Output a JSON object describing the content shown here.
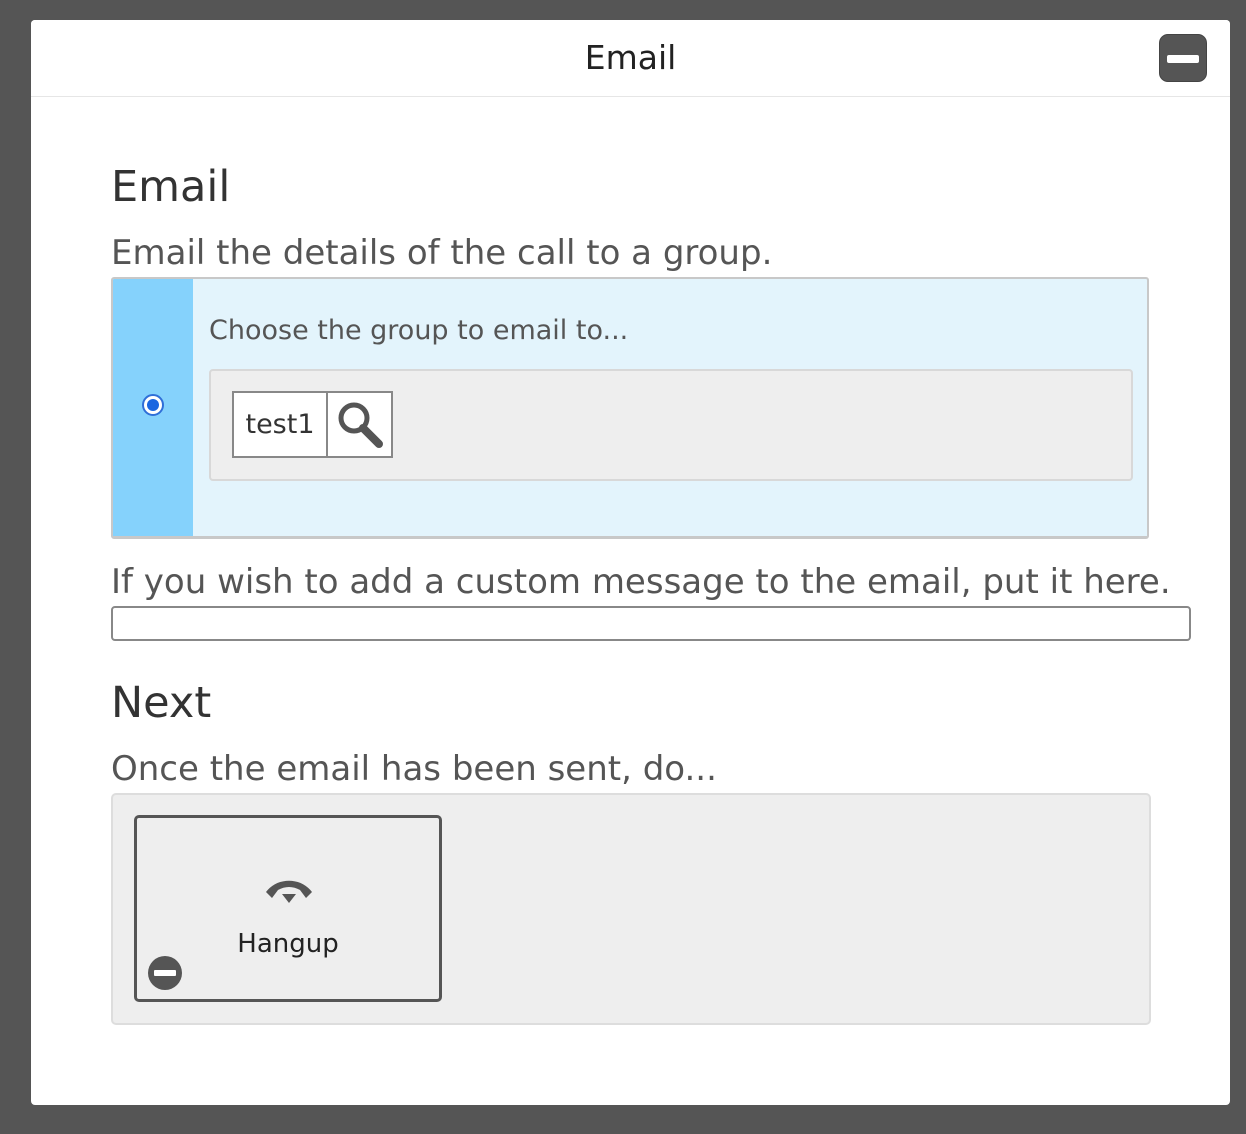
{
  "dialog": {
    "title": "Email"
  },
  "email_section": {
    "heading": "Email",
    "description": "Email the details of the call to a group.",
    "choose_label": "Choose the group to email to...",
    "selected_group": "test1"
  },
  "custom_message": {
    "label": "If you wish to add a custom message to the email, put it here.",
    "value": ""
  },
  "next_section": {
    "heading": "Next",
    "description": "Once the email has been sent, do...",
    "action_label": "Hangup"
  },
  "colors": {
    "backdrop": "#555555",
    "panel_highlight": "#e3f4fc",
    "panel_strip": "#85d2fc",
    "radio_accent": "#1a66e0"
  },
  "icons": [
    "minimize-icon",
    "search-icon",
    "hangup-phone-icon",
    "remove-icon"
  ]
}
